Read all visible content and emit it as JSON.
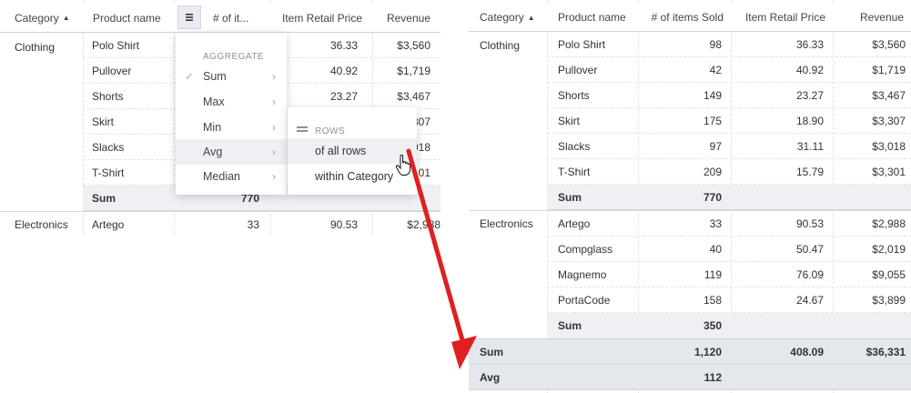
{
  "headers": {
    "category": "Category",
    "product_name": "Product name",
    "items_sold_short": "# of it...",
    "items_sold": "# of items Sold",
    "item_retail_price": "Item Retail Price",
    "revenue": "Revenue"
  },
  "left": {
    "clothing_label": "Clothing",
    "electronics_label": "Electronics",
    "rows": [
      {
        "product": "Polo Shirt",
        "price": "36.33",
        "revenue": "$3,560"
      },
      {
        "product": "Pullover",
        "price": "40.92",
        "revenue": "$1,719"
      },
      {
        "product": "Shorts",
        "price": "23.27",
        "revenue": "$3,467"
      },
      {
        "product": "Skirt",
        "price": "",
        "revenue": "307"
      },
      {
        "product": "Slacks",
        "price": "",
        "revenue": "018"
      },
      {
        "product": "T-Shirt",
        "price": "",
        "revenue": "01"
      }
    ],
    "subtotal_label": "Sum",
    "subtotal_value": "770",
    "electronics_row": {
      "product": "Artego",
      "sold": "33",
      "price": "90.53",
      "revenue": "$2,988"
    }
  },
  "menu": {
    "title": "AGGREGATE",
    "items": [
      {
        "label": "Sum",
        "checked": "✓"
      },
      {
        "label": "Max"
      },
      {
        "label": "Min"
      },
      {
        "label": "Avg"
      },
      {
        "label": "Median"
      }
    ],
    "chevron": "›"
  },
  "submenu": {
    "title": "ROWS",
    "items": [
      {
        "label": "of all rows"
      },
      {
        "label": "within Category"
      }
    ]
  },
  "right": {
    "clothing_label": "Clothing",
    "electronics_label": "Electronics",
    "clothing_rows": [
      {
        "product": "Polo Shirt",
        "sold": "98",
        "price": "36.33",
        "revenue": "$3,560"
      },
      {
        "product": "Pullover",
        "sold": "42",
        "price": "40.92",
        "revenue": "$1,719"
      },
      {
        "product": "Shorts",
        "sold": "149",
        "price": "23.27",
        "revenue": "$3,467"
      },
      {
        "product": "Skirt",
        "sold": "175",
        "price": "18.90",
        "revenue": "$3,307"
      },
      {
        "product": "Slacks",
        "sold": "97",
        "price": "31.11",
        "revenue": "$3,018"
      },
      {
        "product": "T-Shirt",
        "sold": "209",
        "price": "15.79",
        "revenue": "$3,301"
      }
    ],
    "clothing_sum": {
      "label": "Sum",
      "value": "770"
    },
    "electronics_rows": [
      {
        "product": "Artego",
        "sold": "33",
        "price": "90.53",
        "revenue": "$2,988"
      },
      {
        "product": "Compglass",
        "sold": "40",
        "price": "50.47",
        "revenue": "$2,019"
      },
      {
        "product": "Magnemo",
        "sold": "119",
        "price": "76.09",
        "revenue": "$9,055"
      },
      {
        "product": "PortaCode",
        "sold": "158",
        "price": "24.67",
        "revenue": "$3,899"
      }
    ],
    "electronics_sum": {
      "label": "Sum",
      "value": "350"
    },
    "grand_sum": {
      "label": "Sum",
      "sold": "1,120",
      "price": "408.09",
      "revenue": "$36,331"
    },
    "grand_avg": {
      "label": "Avg",
      "sold": "112"
    }
  },
  "colors": {
    "arrow": "#e02020",
    "subtotal_bg": "#eef0f4",
    "grandtotal_bg": "#e4e7ec"
  }
}
